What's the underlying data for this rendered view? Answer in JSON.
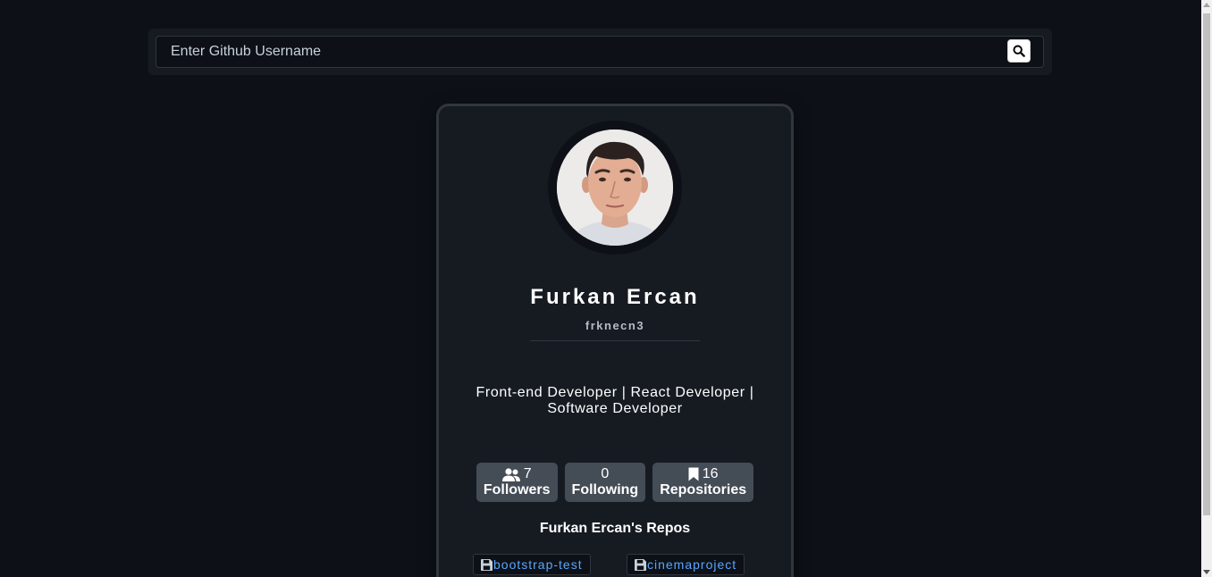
{
  "search": {
    "placeholder": "Enter Github Username",
    "button_icon": "search-icon"
  },
  "profile": {
    "avatar_alt": "Furkan Ercan",
    "name": "Furkan Ercan",
    "login": "frknecn3",
    "bio": "Front-end Developer | React Developer | Software Developer"
  },
  "stats": [
    {
      "icon": "users-icon",
      "count": "7",
      "label": "Followers"
    },
    {
      "icon": "",
      "count": "0",
      "label": "Following"
    },
    {
      "icon": "bookmark-icon",
      "count": "16",
      "label": "Repositories"
    }
  ],
  "repos": {
    "title": "Furkan Ercan's Repos",
    "items": [
      {
        "icon": "floppy-disk-icon",
        "name": "bootstrap-test"
      },
      {
        "icon": "floppy-disk-icon",
        "name": "cinemaproject"
      }
    ]
  },
  "colors": {
    "background": "#0d1117",
    "card": "#161b22",
    "border": "#30363d",
    "stat_bg": "#444c56",
    "link": "#58a6ff"
  }
}
